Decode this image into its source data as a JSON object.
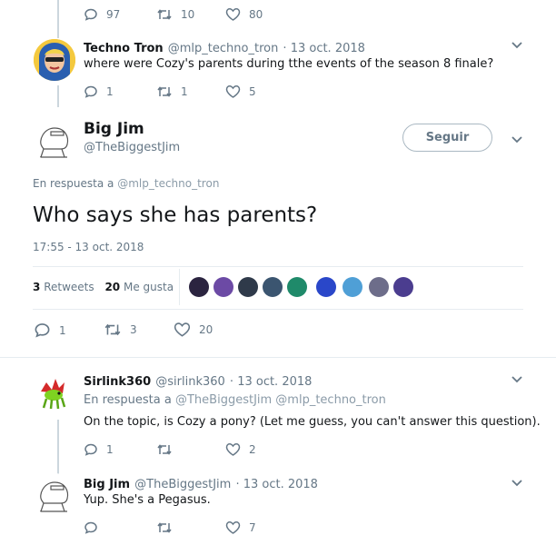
{
  "top_tweet": {
    "replies": "97",
    "retweets": "10",
    "likes": "80"
  },
  "parent_tweet": {
    "name": "Techno Tron",
    "handle": "@mlp_techno_tron",
    "date": "13 oct. 2018",
    "text": "where were Cozy's parents during tthe events of the season 8 finale?",
    "replies": "1",
    "retweets": "1",
    "likes": "5"
  },
  "main_tweet": {
    "name": "Big Jim",
    "handle": "@TheBiggestJim",
    "follow_label": "Seguir",
    "reply_to_prefix": "En respuesta a",
    "reply_to_handle": "@mlp_techno_tron",
    "text": "Who says she has parents?",
    "timestamp": "17:55 - 13 oct. 2018",
    "retweets_count": "3",
    "retweets_label": "Retweets",
    "likes_count": "20",
    "likes_label": "Me gusta",
    "replies": "1",
    "retweets": "3",
    "likes": "20"
  },
  "reply1": {
    "name": "Sirlink360",
    "handle": "@sirlink360",
    "date": "13 oct. 2018",
    "reply_to_prefix": "En respuesta a",
    "reply_to_handles": "@TheBiggestJim @mlp_techno_tron",
    "text": "On the topic, is Cozy a pony?  (Let me guess, you can't answer this question).",
    "replies": "1",
    "likes": "2"
  },
  "reply2": {
    "name": "Big Jim",
    "handle": "@TheBiggestJim",
    "date": "13 oct. 2018",
    "text": "Yup. She's a Pegasus.",
    "likes": "7"
  },
  "colors": {
    "accent": "#1da1f2",
    "muted": "#657786",
    "border": "#e6ecf0"
  }
}
